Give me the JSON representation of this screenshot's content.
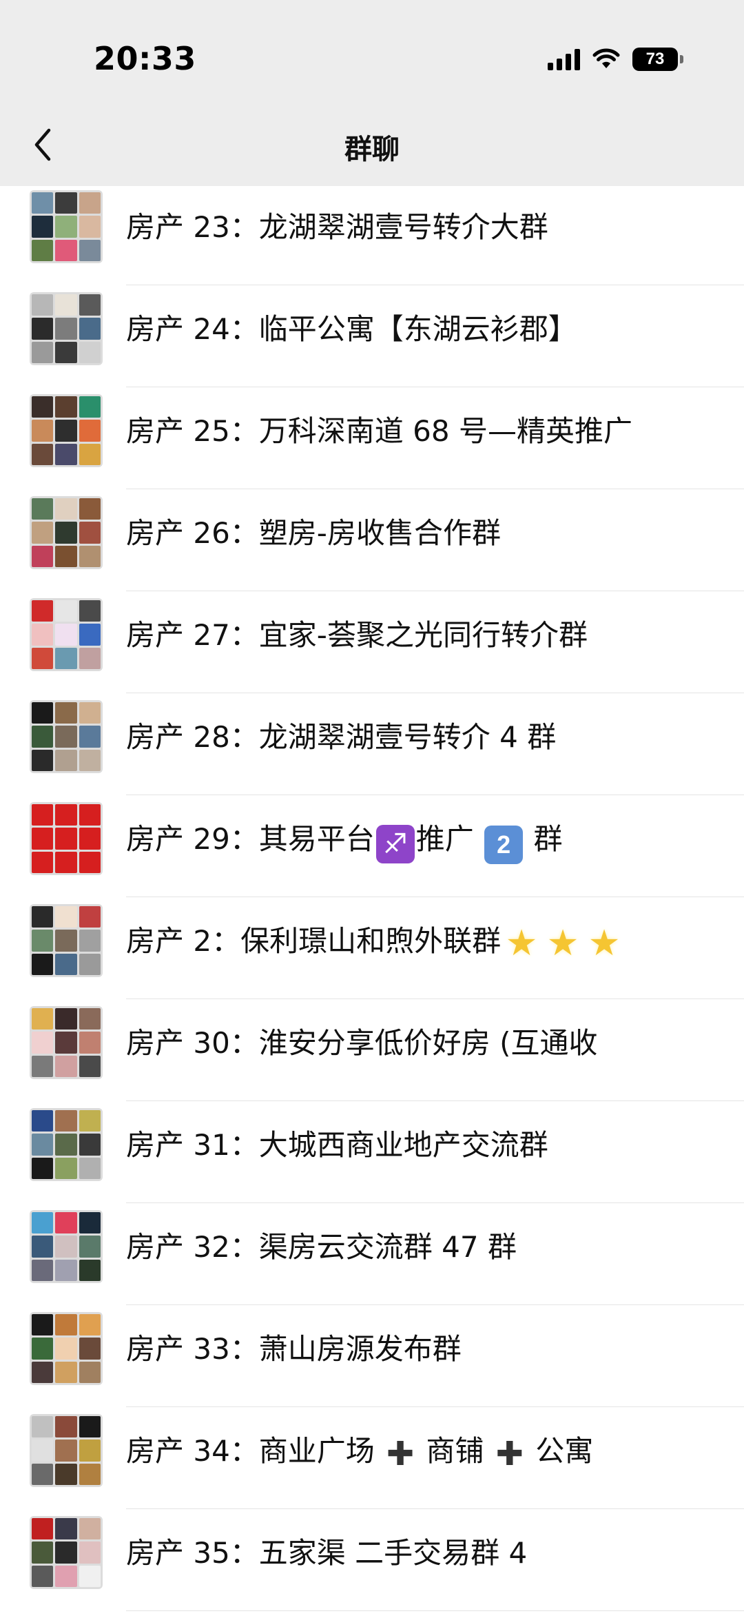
{
  "status_bar": {
    "time": "20:33",
    "battery": "73",
    "icons": [
      "cellular-signal-icon",
      "wifi-icon",
      "battery-icon"
    ]
  },
  "nav": {
    "title": "群聊",
    "back_icon": "chevron-left-icon"
  },
  "groups": [
    {
      "segments": [
        {
          "text": "房产 23：龙湖翠湖壹号转介大群"
        }
      ]
    },
    {
      "segments": [
        {
          "text": "房产 24：临平公寓【东湖云衫郡】"
        }
      ]
    },
    {
      "segments": [
        {
          "text": "房产 25：万科深南道 68 号—精英推广"
        }
      ]
    },
    {
      "segments": [
        {
          "text": "房产 26：塑房-房收售合作群"
        }
      ]
    },
    {
      "segments": [
        {
          "text": "房产 27：宜家-荟聚之光同行转介群"
        }
      ]
    },
    {
      "segments": [
        {
          "text": "房产 28：龙湖翠湖壹号转介 4 群"
        }
      ]
    },
    {
      "segments": [
        {
          "text": "房产 29：其易平台"
        },
        {
          "emoji": "sagittarius",
          "glyph": "♐"
        },
        {
          "text": "推广 "
        },
        {
          "emoji": "keycap",
          "glyph": "2"
        },
        {
          "text": " 群"
        }
      ]
    },
    {
      "segments": [
        {
          "text": "房产 2：保利璟山和煦外联群"
        },
        {
          "emoji": "star",
          "glyph": "★"
        },
        {
          "emoji": "star",
          "glyph": "★"
        },
        {
          "emoji": "star",
          "glyph": "★"
        }
      ]
    },
    {
      "segments": [
        {
          "text": "房产 30：淮安分享低价好房 (互通收"
        }
      ]
    },
    {
      "segments": [
        {
          "text": "房产 31：大城西商业地产交流群"
        }
      ]
    },
    {
      "segments": [
        {
          "text": "房产 32：渠房云交流群  47 群"
        }
      ]
    },
    {
      "segments": [
        {
          "text": "房产 33：萧山房源发布群"
        }
      ]
    },
    {
      "segments": [
        {
          "text": "房产 34：商业广场 "
        },
        {
          "emoji": "plus",
          "glyph": "✚"
        },
        {
          "text": " 商铺 "
        },
        {
          "emoji": "plus",
          "glyph": "✚"
        },
        {
          "text": " 公寓"
        }
      ]
    },
    {
      "segments": [
        {
          "text": "房产 35：五家渠   二手交易群  4"
        }
      ]
    }
  ],
  "avatar_palette": [
    [
      "#6f8fa8",
      "#3c3c3c",
      "#c8a48a",
      "#1e2d3c",
      "#8fb07a",
      "#d9b8a0",
      "#5f7d45",
      "#e05a79",
      "#7a8a9a"
    ],
    [
      "#b7b7b7",
      "#e8e2d8",
      "#5a5a5a",
      "#2b2b2b",
      "#7c7c7c",
      "#4a6b8a",
      "#9a9a9a",
      "#3a3a3a",
      "#d0d0d0"
    ],
    [
      "#3a2e2a",
      "#5b3f2f",
      "#2a8f6b",
      "#c98a5a",
      "#2e2e2e",
      "#e06b3a",
      "#6a4a3a",
      "#4a4a6a",
      "#d9a441"
    ],
    [
      "#5a7a5a",
      "#e0d0c0",
      "#8a5a3a",
      "#c0a080",
      "#2f3a2f",
      "#a05040",
      "#c0405a",
      "#7a5030",
      "#b09070"
    ],
    [
      "#d02a2a",
      "#e6e6e6",
      "#4a4a4a",
      "#f0c0c0",
      "#f0e0f0",
      "#3a6ac0",
      "#d04a3a",
      "#6a9ab0",
      "#c0a0a0"
    ],
    [
      "#1a1a1a",
      "#8a6a4a",
      "#d0b090",
      "#3a5a3a",
      "#7a6a5a",
      "#5a7a9a",
      "#2a2a2a",
      "#b0a090",
      "#c0b0a0"
    ],
    [
      "#d61f1f",
      "#d61f1f",
      "#d61f1f",
      "#d61f1f",
      "#d61f1f",
      "#d61f1f",
      "#d61f1f",
      "#d61f1f",
      "#d61f1f"
    ],
    [
      "#2a2a2a",
      "#f0e0d0",
      "#c04040",
      "#6a8a6a",
      "#7a6a5a",
      "#a0a0a0",
      "#1a1a1a",
      "#4a6a8a",
      "#9a9a9a"
    ],
    [
      "#e0b050",
      "#3a2a2a",
      "#8a6a5a",
      "#f0d0d0",
      "#5a3a3a",
      "#c08070",
      "#7a7a7a",
      "#d0a0a0",
      "#4a4a4a"
    ],
    [
      "#2a4a8a",
      "#a07050",
      "#c0b050",
      "#6a8aa0",
      "#5a6a4a",
      "#3a3a3a",
      "#1a1a1a",
      "#8aa060",
      "#b0b0b0"
    ],
    [
      "#4aa0d0",
      "#e0405a",
      "#1a2a3a",
      "#3a5a7a",
      "#d0c0c0",
      "#5a7a6a",
      "#6a6a7a",
      "#a0a0b0",
      "#2a3a2a"
    ],
    [
      "#1a1a1a",
      "#c07a3a",
      "#e0a050",
      "#3a6a3a",
      "#f0d0b0",
      "#6a4a3a",
      "#4a3a3a",
      "#d0a060",
      "#a08060"
    ],
    [
      "#c0c0c0",
      "#8a4a3a",
      "#1a1a1a",
      "#e0e0e0",
      "#a07050",
      "#c0a040",
      "#6a6a6a",
      "#4a3a2a",
      "#b08040"
    ],
    [
      "#c02020",
      "#3a3a4a",
      "#d0b0a0",
      "#4a5a3a",
      "#2a2a2a",
      "#e0c0c0",
      "#5a5a5a",
      "#e0a0b0",
      "#f0f0f0"
    ]
  ]
}
